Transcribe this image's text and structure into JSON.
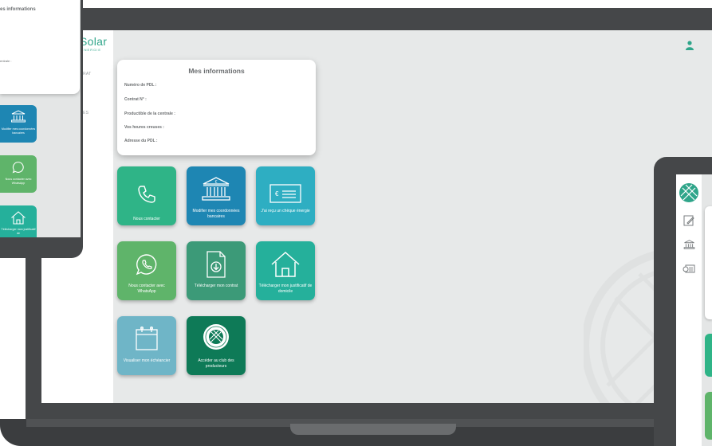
{
  "colors": {
    "brand": "#2fa58a",
    "tile_green": "#2fb487",
    "tile_blue": "#1e86b3",
    "tile_aqua": "#2eaec2",
    "tile_lime": "#5fb46a",
    "tile_mid": "#3c9a78",
    "tile_teal": "#25b09b",
    "tile_sky": "#6fb5c7",
    "tile_dark": "#0e7a57",
    "device_frame": "#454749"
  },
  "laptop": {
    "logo": "Solar",
    "logo_sub": "ENERGIE",
    "nav": [
      "RAT",
      "ES"
    ],
    "user_icon": "user-icon",
    "info": {
      "title": "Mes informations",
      "rows": [
        {
          "label": "Numéro de PDL :"
        },
        {
          "label": "Contrat N° :"
        },
        {
          "label": "Productible de la centrale :"
        },
        {
          "label": "Vos heures creuses :"
        },
        {
          "label": "Adresse du PDL :"
        }
      ]
    },
    "tiles": [
      {
        "label": "Nous contacter",
        "icon": "phone-icon"
      },
      {
        "label": "Modifier mes coordonnées bancaires",
        "icon": "bank-icon"
      },
      {
        "label": "J'ai reçu un chèque énergie",
        "icon": "cheque-icon"
      },
      {
        "label": "Nous contacter avec WhatsApp",
        "icon": "whatsapp-icon"
      },
      {
        "label": "Télécharger mon contrat",
        "icon": "document-download-icon"
      },
      {
        "label": "Télécharger mon justificatif de domicile",
        "icon": "house-icon"
      },
      {
        "label": "Visualiser mon échéancier",
        "icon": "calendar-icon"
      },
      {
        "label": "Accéder au club des producteurs",
        "icon": "club-badge-icon"
      }
    ]
  },
  "tablet": {
    "info_title": "es informations",
    "row_label": "entrale :",
    "tiles": [
      {
        "label": "Modifier mes coordonnées bancaires",
        "icon": "bank-icon"
      },
      {
        "label": "Nous contacter avec WhatsApp",
        "icon": "whatsapp-icon"
      },
      {
        "label": "Télécharger mon justificatif de",
        "icon": "house-icon"
      }
    ]
  },
  "phone": {
    "nav_icons": [
      "logo-globe-icon",
      "edit-icon",
      "bank-icon",
      "cheque-icon"
    ]
  }
}
